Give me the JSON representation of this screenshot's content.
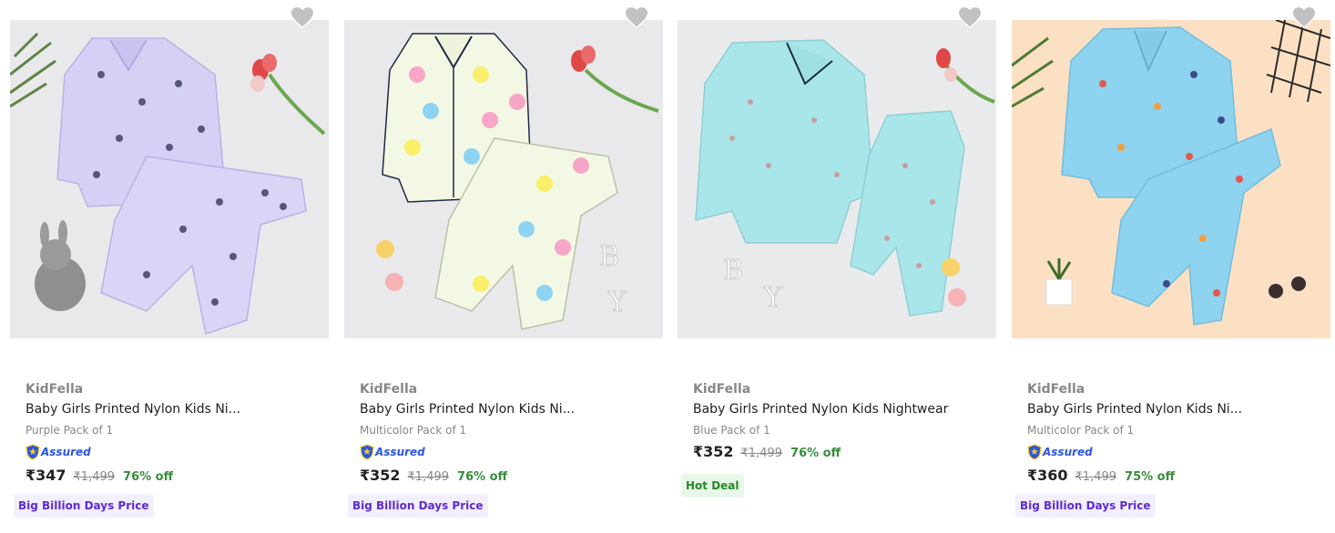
{
  "products": [
    {
      "brand": "KidFella",
      "title": "Baby Girls Printed Nylon Kids Ni...",
      "variant": "Purple Pack of 1",
      "assured": "Assured",
      "price": "₹347",
      "mrp": "₹1,499",
      "discount": "76% off",
      "tag": "Big Billion Days Price",
      "bg_color": "#e9e9eb",
      "garment_color": "#d5d1f4"
    },
    {
      "brand": "KidFella",
      "title": "Baby Girls Printed Nylon Kids Ni...",
      "variant": "Multicolor Pack of 1",
      "assured": "Assured",
      "price": "₹352",
      "mrp": "₹1,499",
      "discount": "76% off",
      "tag": "Big Billion Days Price",
      "bg_color": "#e9e9eb",
      "garment_color": "#f3f8e4"
    },
    {
      "brand": "KidFella",
      "title": "Baby Girls Printed Nylon Kids Nightwear",
      "variant": "Blue Pack of 1",
      "price": "₹352",
      "mrp": "₹1,499",
      "discount": "76% off",
      "tag": "Hot Deal",
      "bg_color": "#e9eaec",
      "garment_color": "#a8e6e9"
    },
    {
      "brand": "KidFella",
      "title": "Baby Girls Printed Nylon Kids Ni...",
      "variant": "Multicolor Pack of 1",
      "assured": "Assured",
      "price": "₹360",
      "mrp": "₹1,499",
      "discount": "75% off",
      "tag": "Big Billion Days Price",
      "bg_color": "#fce0c4",
      "garment_color": "#8ed3ef"
    }
  ],
  "colors": {
    "discount": "#388e3c",
    "assured": "#2a55e5",
    "big_billion_bg": "#f2efff",
    "hot_deal_bg": "#e9f7ea",
    "wishlist": "#c2c2c2"
  }
}
